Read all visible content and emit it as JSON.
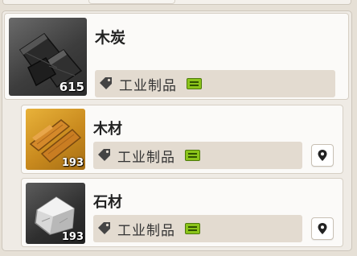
{
  "colors": {
    "badge_green": "#8bc41a",
    "tag_bg": "#e3dbd0",
    "card_bg": "#fbfaf8"
  },
  "items": [
    {
      "name": "木炭",
      "quantity": "615",
      "category": "工业制品",
      "icon": "charcoal-icon",
      "category_icon": "tag-icon",
      "badge_icon": "green-badge-icon"
    },
    {
      "name": "木材",
      "quantity": "193",
      "category": "工业制品",
      "icon": "wood-icon",
      "category_icon": "tag-icon",
      "badge_icon": "green-badge-icon",
      "action_icon": "location-pin-icon"
    },
    {
      "name": "石材",
      "quantity": "193",
      "category": "工业制品",
      "icon": "stone-icon",
      "category_icon": "tag-icon",
      "badge_icon": "green-badge-icon",
      "action_icon": "location-pin-icon"
    }
  ]
}
